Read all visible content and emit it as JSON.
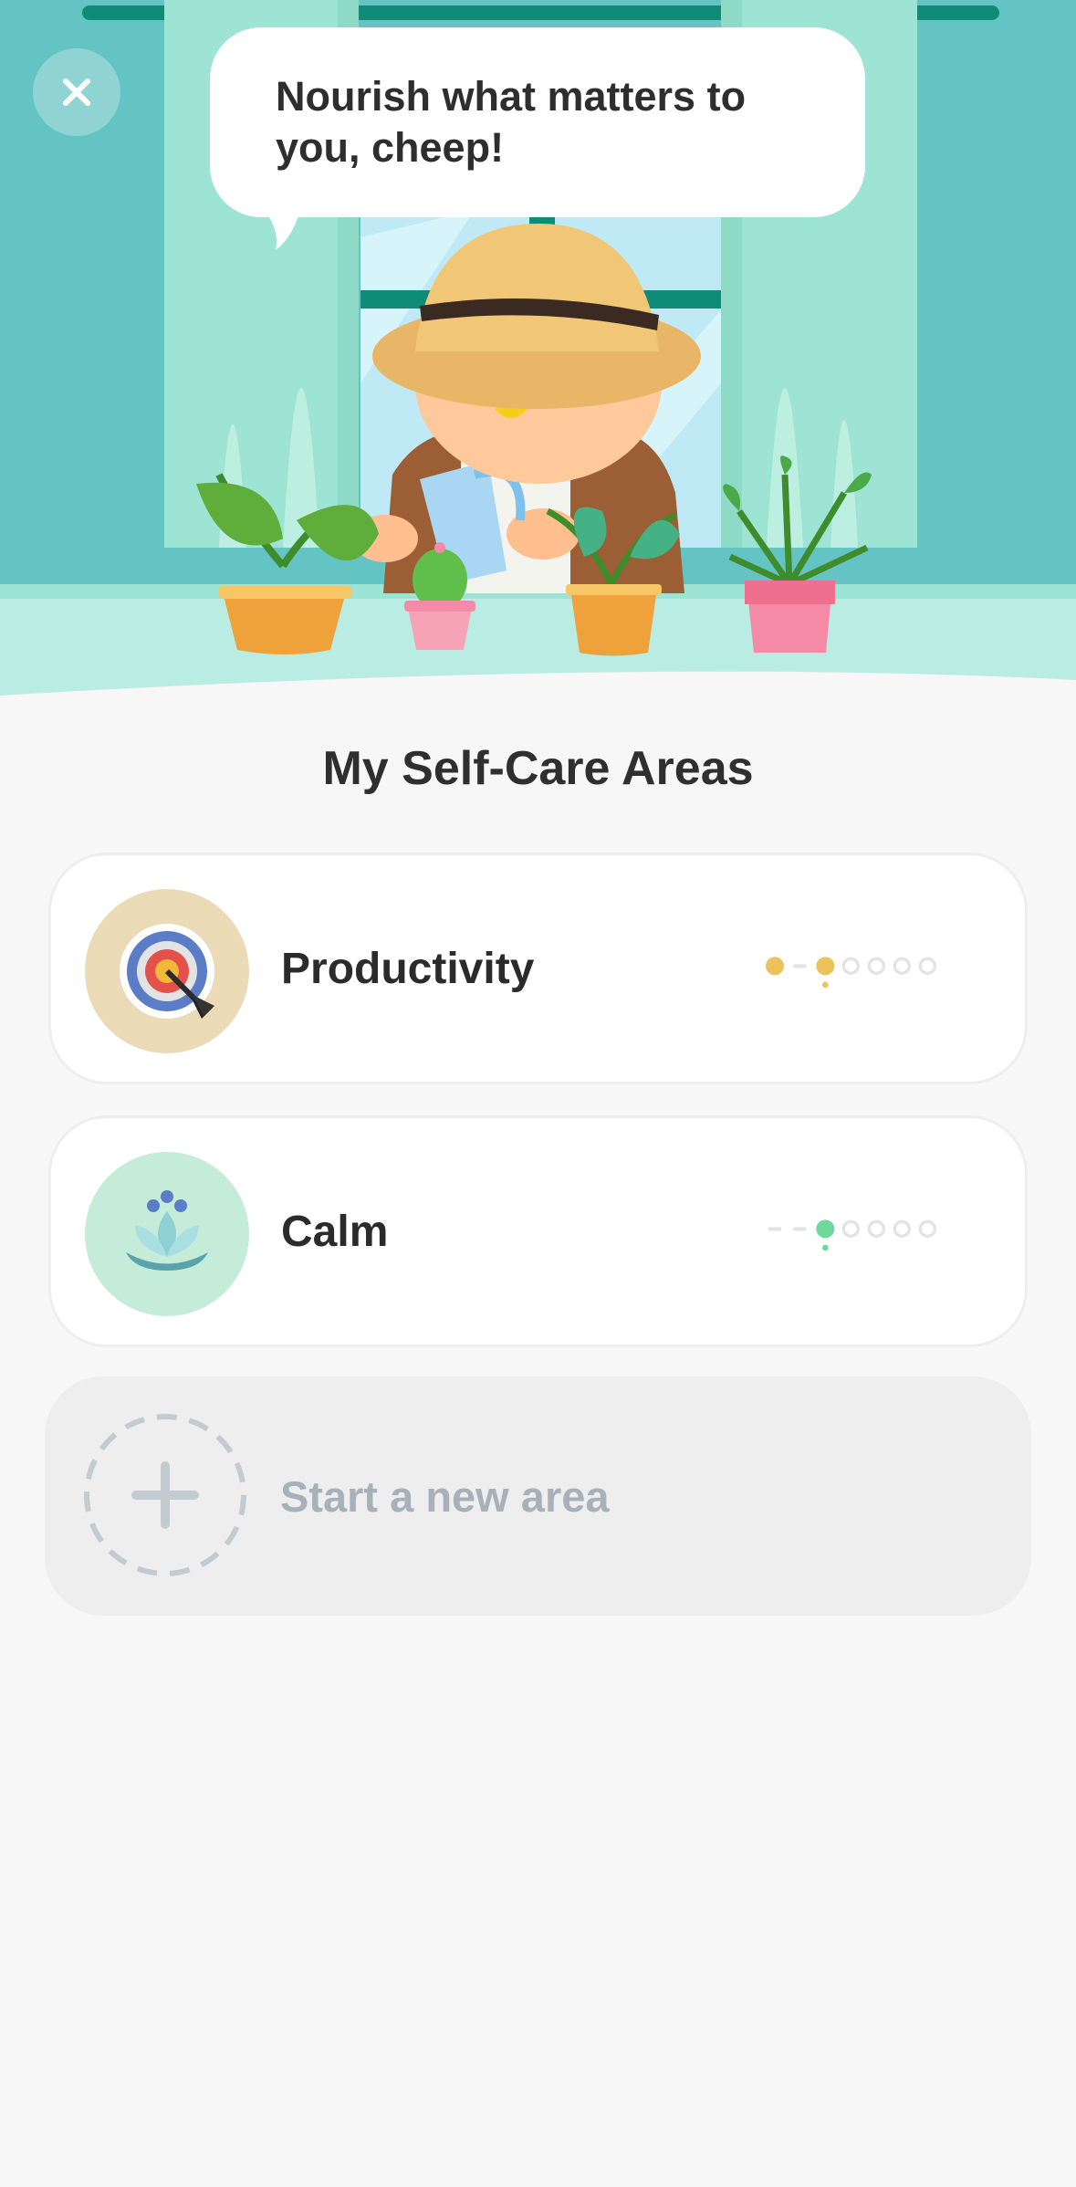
{
  "header": {
    "close_icon": "close-icon",
    "speech": "Nourish what matters to you, cheep!"
  },
  "section_title": "My Self-Care Areas",
  "areas": [
    {
      "label": "Productivity",
      "icon": "target-icon",
      "badge_color": "#eadbb6",
      "accent_color": "#ecc25a",
      "completed_steps": 2,
      "current_step": 2,
      "total_steps": 6
    },
    {
      "label": "Calm",
      "icon": "lotus-icon",
      "badge_color": "#c4ecd8",
      "accent_color": "#6fd99b",
      "completed_steps": 1,
      "current_step": 2,
      "total_steps": 6
    }
  ],
  "new_area": {
    "label": "Start a new area",
    "icon": "plus-icon"
  },
  "colors": {
    "wall": "#64c4c3",
    "curtain": "#9ee4d4",
    "floor": "#b9ede3",
    "background": "#f7f7f7"
  }
}
